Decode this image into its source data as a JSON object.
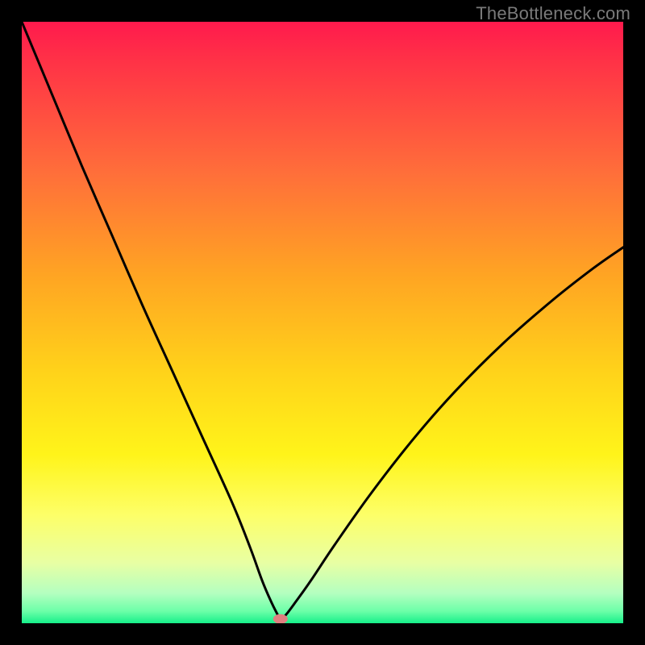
{
  "watermark": "TheBottleneck.com",
  "chart_data": {
    "type": "line",
    "title": "",
    "xlabel": "",
    "ylabel": "",
    "xlim": [
      0,
      100
    ],
    "ylim": [
      0,
      100
    ],
    "grid": false,
    "legend": false,
    "marker": {
      "x": 43,
      "y": 0.7,
      "color": "#e08080"
    },
    "series": [
      {
        "name": "curve",
        "x": [
          0,
          5,
          10,
          15,
          20,
          25,
          30,
          35,
          38,
          40,
          41.5,
          42.5,
          43,
          44,
          45.5,
          48,
          52,
          58,
          65,
          72,
          80,
          88,
          95,
          100
        ],
        "y": [
          100,
          88,
          76,
          64.5,
          53,
          42,
          31,
          20,
          12.5,
          7,
          3.5,
          1.5,
          0.5,
          1.5,
          3.5,
          7,
          13,
          21.5,
          30.5,
          38.5,
          46.5,
          53.5,
          59,
          62.5
        ]
      }
    ],
    "background_gradient": {
      "orientation": "vertical",
      "stops": [
        {
          "pos": 0.0,
          "color": "#ff1a4d"
        },
        {
          "pos": 0.06,
          "color": "#ff3047"
        },
        {
          "pos": 0.25,
          "color": "#ff6e3a"
        },
        {
          "pos": 0.42,
          "color": "#ffa423"
        },
        {
          "pos": 0.58,
          "color": "#ffd21a"
        },
        {
          "pos": 0.72,
          "color": "#fff41a"
        },
        {
          "pos": 0.82,
          "color": "#fdff68"
        },
        {
          "pos": 0.9,
          "color": "#e8ffa4"
        },
        {
          "pos": 0.95,
          "color": "#b4ffc0"
        },
        {
          "pos": 0.98,
          "color": "#6cffa8"
        },
        {
          "pos": 1.0,
          "color": "#16f08a"
        }
      ]
    }
  }
}
